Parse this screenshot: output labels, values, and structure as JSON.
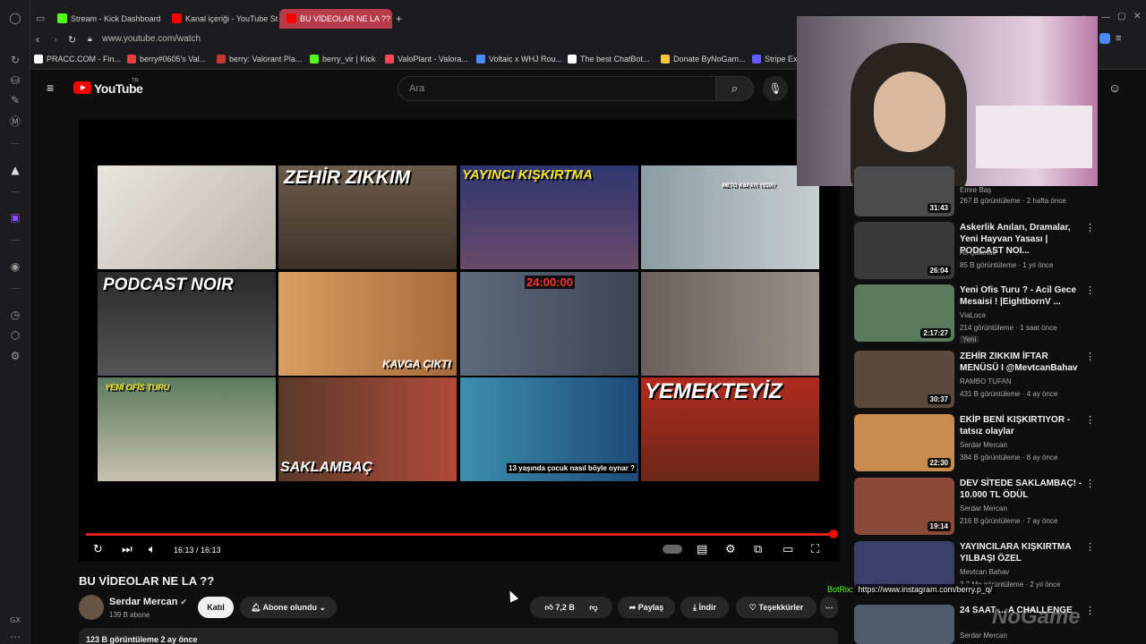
{
  "browser": {
    "tabs": [
      {
        "label": "Stream - Kick Dashboard",
        "color": "#53fc18"
      },
      {
        "label": "Kanal içeriği - YouTube St",
        "color": "#ff0000"
      },
      {
        "label": "BU VİDEOLAR NE LA ?? -",
        "color": "#ff0000"
      }
    ],
    "url": "www.youtube.com/watch",
    "bookmarks": [
      {
        "label": "PRACC.COM - Fin...",
        "color": "#ffffff"
      },
      {
        "label": "berry#0605's Val...",
        "color": "#e53e3e"
      },
      {
        "label": "berry: Valorant Pla...",
        "color": "#c0392b"
      },
      {
        "label": "berry_vir | Kick",
        "color": "#53fc18"
      },
      {
        "label": "ValoPlant - Valora...",
        "color": "#ff4655"
      },
      {
        "label": "Voltaic x WHJ Rou...",
        "color": "#4a8cff"
      },
      {
        "label": "The best ChatBot...",
        "color": "#ffffff"
      },
      {
        "label": "Donate ByNoGam...",
        "color": "#f5c542"
      },
      {
        "label": "Stripe Ex",
        "color": "#635bff"
      }
    ],
    "sidebar_bottom": "GX"
  },
  "youtube": {
    "logo": "YouTube",
    "region": "TR",
    "search_placeholder": "Ara"
  },
  "player": {
    "time": "16:13 / 16:13",
    "endscreen": [
      {
        "text": "",
        "bg": "#d9d6d0"
      },
      {
        "text": "ZEHİR ZIKKIM",
        "bg": "#5a4a3e"
      },
      {
        "text": "YAYINCI KIŞKIRTMA",
        "bg": "#3a3f6a"
      },
      {
        "text": "METO KAFAYI YEDİ!!",
        "bg": "#7d8a90"
      },
      {
        "text": "PODCAST NOIR",
        "bg": "#3a3a3a"
      },
      {
        "text": "KAVGA ÇIKTI",
        "bg": "#c98b4e"
      },
      {
        "text": "24:00:00",
        "bg": "#4f5a6a"
      },
      {
        "text": "",
        "bg": "#7a6e6a"
      },
      {
        "text": "YENİ OFİS TURU",
        "bg": "#5b7a5e"
      },
      {
        "text": "SAKLAMBAÇ",
        "bg": "#8a4a3a"
      },
      {
        "text": "13 yaşında çocuk nasıl böyle oynar ?",
        "bg": "#3c8fb0"
      },
      {
        "text": "YEMEKTEYİZ",
        "bg": "#a8281f"
      }
    ]
  },
  "video": {
    "title": "BU VİDEOLAR NE LA ??",
    "channel": "Serdar Mercan",
    "subscribers": "139 B abone",
    "join": "Katıl",
    "subscribed": "Abone olundu",
    "likes": "7,2 B",
    "share": "Paylaş",
    "download": "İndir",
    "thanks": "Teşekkürler",
    "views": "123 B görüntüleme  2 ay önce"
  },
  "related": [
    {
      "title": "",
      "channel": "Emre Baş",
      "meta": "267 B görüntüleme · 2 hafta önce",
      "duration": "31:43",
      "bg": "#4b4b4b"
    },
    {
      "title": "Askerlik Anıları, Dramalar, Yeni Hayvan Yasası | PODCAST NOI...",
      "channel": "Ali Çakmak",
      "meta": "85 B görüntüleme · 1 yıl önce",
      "duration": "26:04",
      "bg": "#3a3a3a"
    },
    {
      "title": "Yeni Ofis Turu ? - Acil Gece Mesaisi ! |EightbornV ...",
      "channel": "ViaLoca",
      "meta": "214 görüntüleme · 1 saat önce",
      "duration": "2:17:27",
      "badge": "Yeni",
      "bg": "#5b7a5e"
    },
    {
      "title": "ZEHİR ZIKKIM İFTAR MENÜSÜ I @MevtcanBahav",
      "channel": "RAMBO TUFAN",
      "meta": "431 B görüntüleme · 4 ay önce",
      "duration": "30:37",
      "bg": "#5a4a3e"
    },
    {
      "title": "EKİP BENİ KIŞKIRTIYOR - tatsız olaylar",
      "channel": "Serdar Mercan",
      "meta": "384 B görüntüleme · 8 ay önce",
      "duration": "22:30",
      "bg": "#c98b4e"
    },
    {
      "title": "DEV SİTEDE SAKLAMBAÇ! - 10.000 TL ÖDÜL",
      "channel": "Serdar Mercan",
      "meta": "216 B görüntüleme · 7 ay önce",
      "duration": "19:14",
      "bg": "#8a4a3a"
    },
    {
      "title": "YAYINCILARA KIŞKIRTMA YILBAŞI ÖZEL",
      "channel": "Mevtcan Bahav",
      "meta": "2,7 Mn görüntüleme · 2 yıl önce",
      "duration": "",
      "bg": "#3a3f6a"
    },
    {
      "title": "24 SAAT ... A CHALLENGE",
      "channel": "Serdar Mercan",
      "meta": "",
      "duration": "",
      "bg": "#4f5a6a"
    }
  ],
  "chat": {
    "user": "BotRix",
    "message": "https://www.instagram.com/berry.p_q/"
  },
  "watermark": "NoGame"
}
